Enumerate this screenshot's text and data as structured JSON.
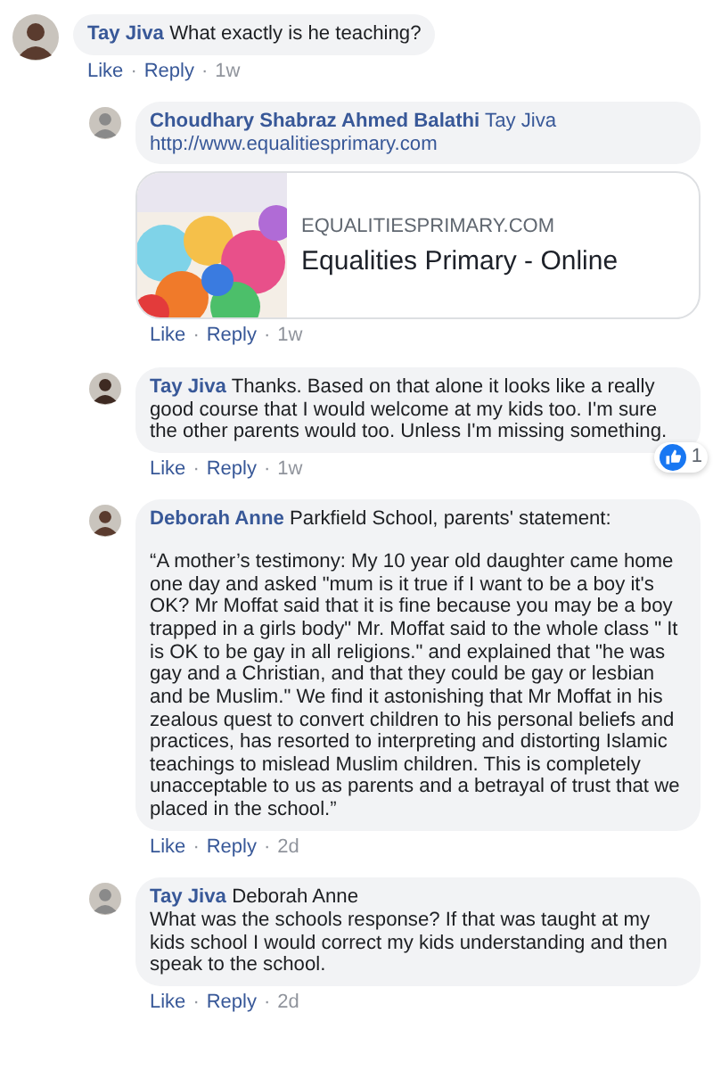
{
  "comments": [
    {
      "author": "Tay Jiva",
      "mention": false,
      "heading": "What exactly is he teaching?",
      "actions": [
        "Like",
        "Reply"
      ],
      "separator": "·",
      "time": "1w",
      "replies": [
        {
          "author": "Choudhary Shabraz Ahmed Balathi",
          "mention": true,
          "heading": "Tay Jiva",
          "link": "http://www.equalitiesprimary.com",
          "preview": {
            "kind": "picture",
            "domain": "EQUALITIESPRIMARY.COM",
            "title": "Equalities Primary - Online"
          },
          "actions": [
            "Like",
            "Reply"
          ],
          "separator": "·",
          "time": "1w"
        },
        {
          "author": "Tay Jiva",
          "mention": false,
          "heading": "Thanks. Based on that alone it looks like a really good course that I would welcome at my kids too. I'm sure the other parents would too. Unless I'm missing something.",
          "reaction": {
            "count": "1"
          },
          "actions": [
            "Like",
            "Reply"
          ],
          "separator": "·",
          "time": "1w"
        },
        {
          "author": "Deborah Anne",
          "mention": false,
          "heading": "Parkfield School, parents' statement:",
          "body": "“A mother’s testimony: My 10 year old daughter came home one day and asked \"mum is it true if I want to be a boy it's OK? Mr Moffat said that it is fine because you may be a boy trapped in a girls body\" Mr. Moffat said to the whole class \" It is OK to be gay in all religions.\" and explained that \"he was gay and a Christian, and that they could be gay or lesbian and be Muslim.\" We find it astonishing that Mr Moffat in his zealous quest to convert children to his personal beliefs and practices, has resorted to interpreting and distorting Islamic teachings to mislead Muslim children. This is completely unacceptable to us as parents and a betrayal of trust that we placed in the school.”",
          "actions": [
            "Like",
            "Reply"
          ],
          "separator": "·",
          "time": "2d"
        },
        {
          "author": "Tay Jiva",
          "mention": false,
          "heading": "Deborah Anne\nWhat was the schools response? If that was taught at my kids school I would correct my kids understanding and then speak to the school.",
          "actions": [
            "Like",
            "Reply"
          ],
          "separator": "·",
          "time": "2d"
        }
      ]
    }
  ]
}
